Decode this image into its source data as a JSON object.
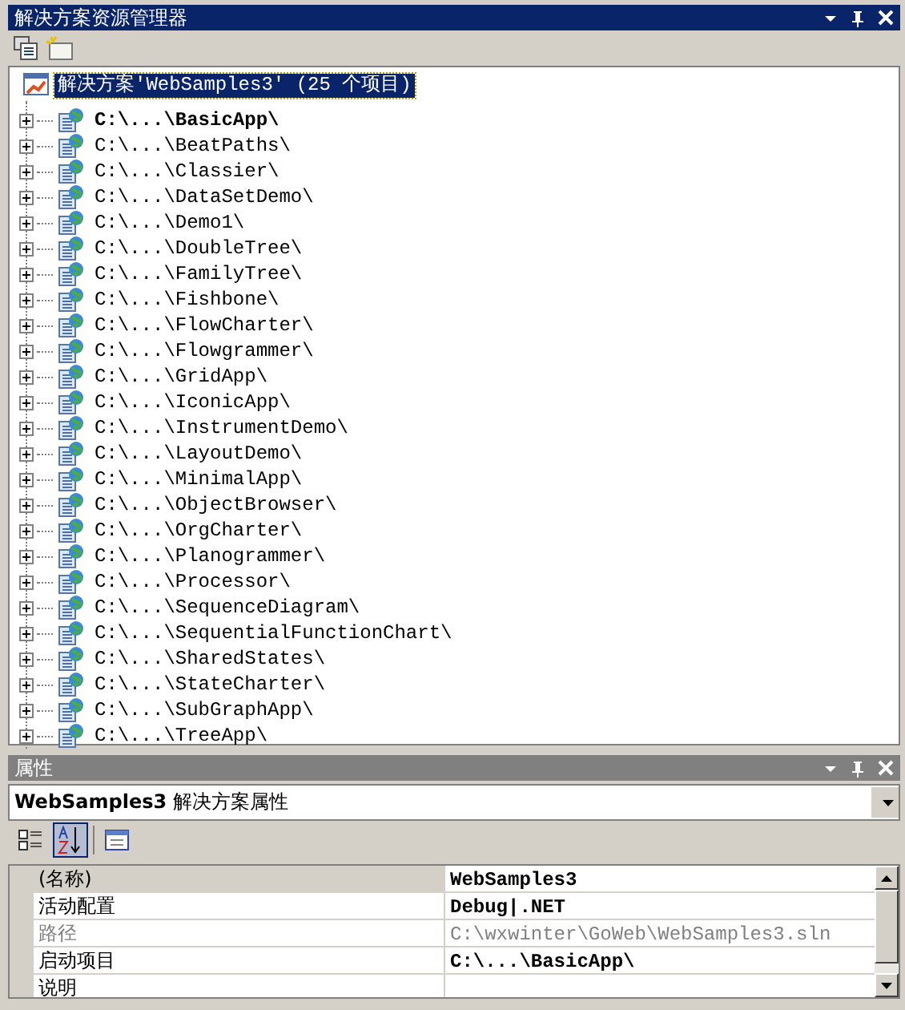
{
  "solution_explorer": {
    "title": "解决方案资源管理器",
    "root": {
      "label": "解决方案'WebSamples3' (25 个项目)",
      "selected": true
    },
    "projects": [
      {
        "label": "C:\\...\\BasicApp\\",
        "startup": true,
        "expanded": false,
        "selected": false
      },
      {
        "label": "C:\\...\\BeatPaths\\",
        "startup": false,
        "expanded": false,
        "selected": false
      },
      {
        "label": "C:\\...\\Classier\\",
        "startup": false,
        "expanded": false,
        "selected": false
      },
      {
        "label": "C:\\...\\DataSetDemo\\",
        "startup": false,
        "expanded": false,
        "selected": false
      },
      {
        "label": "C:\\...\\Demo1\\",
        "startup": false,
        "expanded": false,
        "selected": false
      },
      {
        "label": "C:\\...\\DoubleTree\\",
        "startup": false,
        "expanded": false,
        "selected": false
      },
      {
        "label": "C:\\...\\FamilyTree\\",
        "startup": false,
        "expanded": false,
        "selected": false
      },
      {
        "label": "C:\\...\\Fishbone\\",
        "startup": false,
        "expanded": false,
        "selected": false
      },
      {
        "label": "C:\\...\\FlowCharter\\",
        "startup": false,
        "expanded": false,
        "selected": false
      },
      {
        "label": "C:\\...\\Flowgrammer\\",
        "startup": false,
        "expanded": false,
        "selected": false
      },
      {
        "label": "C:\\...\\GridApp\\",
        "startup": false,
        "expanded": false,
        "selected": false
      },
      {
        "label": "C:\\...\\IconicApp\\",
        "startup": false,
        "expanded": false,
        "selected": false
      },
      {
        "label": "C:\\...\\InstrumentDemo\\",
        "startup": false,
        "expanded": false,
        "selected": false
      },
      {
        "label": "C:\\...\\LayoutDemo\\",
        "startup": false,
        "expanded": false,
        "selected": false
      },
      {
        "label": "C:\\...\\MinimalApp\\",
        "startup": false,
        "expanded": false,
        "selected": false
      },
      {
        "label": "C:\\...\\ObjectBrowser\\",
        "startup": false,
        "expanded": false,
        "selected": false
      },
      {
        "label": "C:\\...\\OrgCharter\\",
        "startup": false,
        "expanded": false,
        "selected": false
      },
      {
        "label": "C:\\...\\Planogrammer\\",
        "startup": false,
        "expanded": false,
        "selected": false
      },
      {
        "label": "C:\\...\\Processor\\",
        "startup": false,
        "expanded": false,
        "selected": false
      },
      {
        "label": "C:\\...\\SequenceDiagram\\",
        "startup": false,
        "expanded": false,
        "selected": false
      },
      {
        "label": "C:\\...\\SequentialFunctionChart\\",
        "startup": false,
        "expanded": false,
        "selected": false
      },
      {
        "label": "C:\\...\\SharedStates\\",
        "startup": false,
        "expanded": false,
        "selected": false
      },
      {
        "label": "C:\\...\\StateCharter\\",
        "startup": false,
        "expanded": false,
        "selected": false
      },
      {
        "label": "C:\\...\\SubGraphApp\\",
        "startup": false,
        "expanded": false,
        "selected": false
      },
      {
        "label": "C:\\...\\TreeApp\\",
        "startup": false,
        "expanded": false,
        "selected": false
      }
    ]
  },
  "properties": {
    "title": "属性",
    "object_selector": "**WebSamples3** 解决方案属性",
    "toolbar": [
      {
        "kind": "categorized",
        "selected": false
      },
      {
        "kind": "alphabetical",
        "selected": true
      },
      {
        "kind": "property-pages",
        "selected": false
      }
    ],
    "rows": [
      {
        "name": "(名称)",
        "value": "WebSamples3",
        "selected": true,
        "disabled": false
      },
      {
        "name": "活动配置",
        "value": "Debug|.NET",
        "selected": false,
        "disabled": false
      },
      {
        "name": "路径",
        "value": "C:\\wxwinter\\GoWeb\\WebSamples3.sln",
        "selected": false,
        "disabled": true
      },
      {
        "name": "启动项目",
        "value": "C:\\...\\BasicApp\\",
        "selected": false,
        "disabled": false
      },
      {
        "name": "说明",
        "value": "",
        "selected": false,
        "disabled": false
      }
    ]
  }
}
